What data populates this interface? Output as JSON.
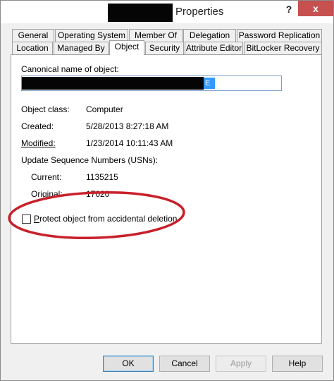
{
  "window": {
    "title": "Properties",
    "help_label": "?",
    "close_label": "x"
  },
  "tabs": {
    "row1": [
      "General",
      "Operating System",
      "Member Of",
      "Delegation",
      "Password Replication"
    ],
    "row2": [
      "Location",
      "Managed By",
      "Object",
      "Security",
      "Attribute Editor",
      "BitLocker Recovery"
    ],
    "active": "Object"
  },
  "object": {
    "canonical_label": "Canonical name of object:",
    "canonical_value_visible": "E",
    "class_label": "Object class:",
    "class_value": "Computer",
    "created_label": "Created:",
    "created_value": "5/28/2013 8:27:18 AM",
    "modified_label": "Modified:",
    "modified_value": "1/23/2014 10:11:43 AM",
    "usn_label": "Update Sequence Numbers (USNs):",
    "current_label": "Current:",
    "current_value": "1135215",
    "original_label": "Original:",
    "original_value": "17020",
    "protect_label": "Protect object from accidental deletion",
    "protect_checked": false
  },
  "buttons": {
    "ok": "OK",
    "cancel": "Cancel",
    "apply": "Apply",
    "help": "Help"
  },
  "colors": {
    "annotation_oval": "#c8202a",
    "close_button": "#c75050",
    "selection": "#3399ff"
  }
}
